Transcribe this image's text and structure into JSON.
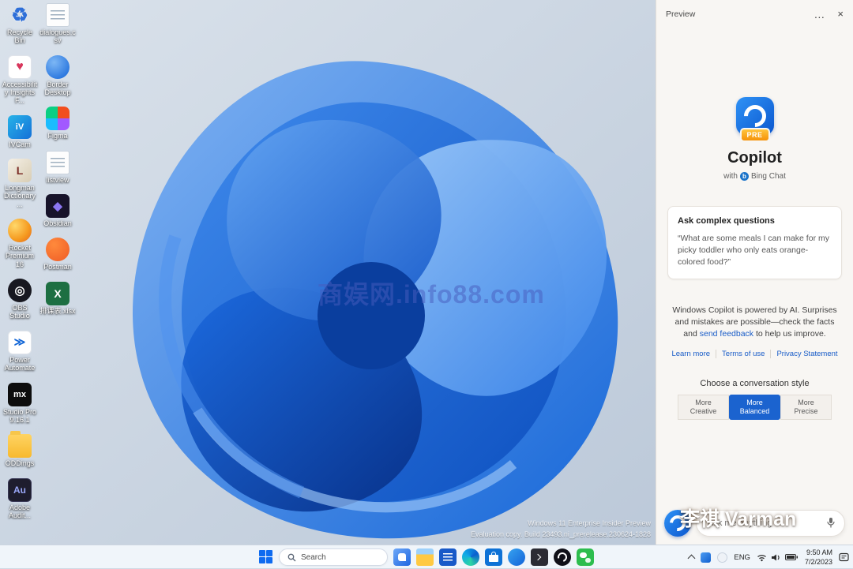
{
  "colors": {
    "accent": "#1b63cf",
    "badge_orange": "#f59208",
    "excel_green": "#1d6f42"
  },
  "desktop": {
    "watermark": "商娱网.info88.com",
    "build_lines": [
      "Windows 11 Enterprise Insider Preview",
      "Evaluation copy. Build 23493.ni_prerelease.230624-1828"
    ],
    "icons": [
      {
        "label": "Recycle Bin",
        "glyph": "♻"
      },
      {
        "label": "Accessibility Insights F...",
        "glyph": "♥"
      },
      {
        "label": "IVCam",
        "glyph": "iV"
      },
      {
        "label": "Longman Dictionary ...",
        "glyph": "L"
      },
      {
        "label": "Rocket Premium 16",
        "glyph": ""
      },
      {
        "label": "OBS Studio",
        "glyph": "◎"
      },
      {
        "label": "Power Automate",
        "glyph": "≫"
      },
      {
        "label": "Studio Pro 9.16.1",
        "glyph": "mx"
      },
      {
        "label": "ODDings",
        "glyph": ""
      },
      {
        "label": "Adobe Audit...",
        "glyph": "Au"
      },
      {
        "label": "dialogues.csv",
        "glyph": ""
      },
      {
        "label": "Border Desktop",
        "glyph": ""
      },
      {
        "label": "Figma",
        "glyph": ""
      },
      {
        "label": "listview",
        "glyph": ""
      },
      {
        "label": "Obsidian",
        "glyph": "◆"
      },
      {
        "label": "Postman",
        "glyph": ""
      },
      {
        "label": "排课表.xlsx",
        "glyph": "X"
      }
    ]
  },
  "copilot": {
    "header_title": "Preview",
    "menu_glyph": "…",
    "close_glyph": "×",
    "badge": "PRE",
    "title": "Copilot",
    "subtitle_prefix": "with",
    "bing_glyph": "b",
    "subtitle_brand": "Bing Chat",
    "card_title": "Ask complex questions",
    "card_quote": "“What are some meals I can make for my picky toddler who only eats orange-colored food?”",
    "disclaimer_before": "Windows Copilot is powered by AI. Surprises and mistakes are possible—check the facts and",
    "disclaimer_link": "send feedback",
    "disclaimer_after": "to help us improve.",
    "links": [
      "Learn more",
      "Terms of use",
      "Privacy Statement"
    ],
    "style_label": "Choose a conversation style",
    "styles": [
      {
        "line1": "More",
        "line2": "Creative"
      },
      {
        "line1": "More",
        "line2": "Balanced"
      },
      {
        "line1": "More",
        "line2": "Precise"
      }
    ],
    "input_placeholder": "Ask me anything",
    "watermark": "李祺 Varman"
  },
  "taskbar": {
    "search_placeholder": "Search",
    "tray_lang": "ENG",
    "time": "9:50 AM",
    "date": "7/2/2023"
  }
}
